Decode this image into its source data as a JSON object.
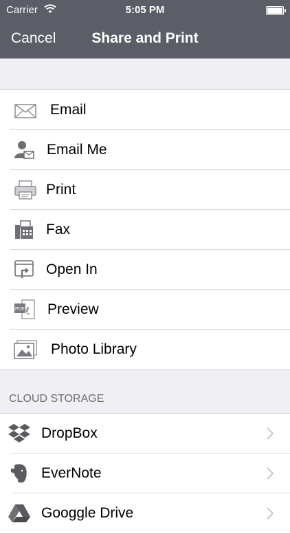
{
  "status": {
    "carrier": "Carrier",
    "time": "5:05 PM"
  },
  "nav": {
    "cancel": "Cancel",
    "title": "Share and Print"
  },
  "share_items": [
    {
      "label": "Email",
      "icon": "envelope-icon"
    },
    {
      "label": "Email Me",
      "icon": "user-mail-icon"
    },
    {
      "label": "Print",
      "icon": "printer-icon"
    },
    {
      "label": "Fax",
      "icon": "fax-icon"
    },
    {
      "label": "Open In",
      "icon": "open-in-icon"
    },
    {
      "label": "Preview",
      "icon": "pdf-icon"
    },
    {
      "label": "Photo Library",
      "icon": "photo-library-icon"
    }
  ],
  "cloud": {
    "header": "CLOUD STORAGE",
    "items": [
      {
        "label": "DropBox",
        "icon": "dropbox-icon"
      },
      {
        "label": "EverNote",
        "icon": "evernote-icon"
      },
      {
        "label": "Googgle Drive",
        "icon": "google-drive-icon"
      }
    ]
  },
  "colors": {
    "nav_bg": "#5b5e66",
    "page_bg": "#efeff4",
    "icon_gray": "#7a7a7f"
  }
}
